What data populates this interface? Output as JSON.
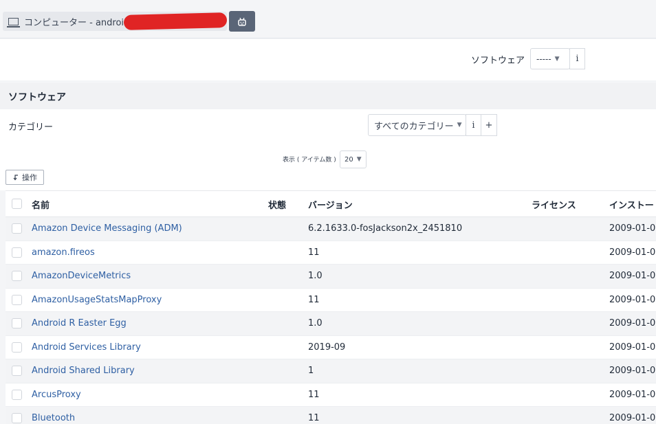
{
  "header": {
    "title": "コンピューター - android",
    "computer_icon": "computer-icon",
    "android_icon": "android-icon"
  },
  "filter": {
    "label": "ソフトウェア",
    "select_value": "-----",
    "info_label": "i"
  },
  "section": {
    "title": "ソフトウェア",
    "category_label": "カテゴリー",
    "category_value": "すべてのカテゴリー",
    "info_label": "i",
    "add_label": "+"
  },
  "pager": {
    "label": "表示 ( アイテム数 )",
    "value": "20"
  },
  "actions": {
    "label": "操作"
  },
  "table": {
    "columns": {
      "name": "名前",
      "status": "状態",
      "version": "バージョン",
      "license": "ライセンス",
      "install": "インストー"
    },
    "rows": [
      {
        "name": "Amazon Device Messaging (ADM)",
        "version": "6.2.1633.0-fosJackson2x_2451810",
        "date": "2009-01-0"
      },
      {
        "name": "amazon.fireos",
        "version": "11",
        "date": "2009-01-0"
      },
      {
        "name": "AmazonDeviceMetrics",
        "version": "1.0",
        "date": "2009-01-0"
      },
      {
        "name": "AmazonUsageStatsMapProxy",
        "version": "11",
        "date": "2009-01-0"
      },
      {
        "name": "Android R Easter Egg",
        "version": "1.0",
        "date": "2009-01-0"
      },
      {
        "name": "Android Services Library",
        "version": "2019-09",
        "date": "2009-01-0"
      },
      {
        "name": "Android Shared Library",
        "version": "1",
        "date": "2009-01-0"
      },
      {
        "name": "ArcusProxy",
        "version": "11",
        "date": "2009-01-0"
      },
      {
        "name": "Bluetooth",
        "version": "11",
        "date": "2009-01-0"
      }
    ]
  },
  "colors": {
    "link": "#2e5fa3",
    "redaction": "#e02424",
    "android_button": "#5a6577"
  }
}
